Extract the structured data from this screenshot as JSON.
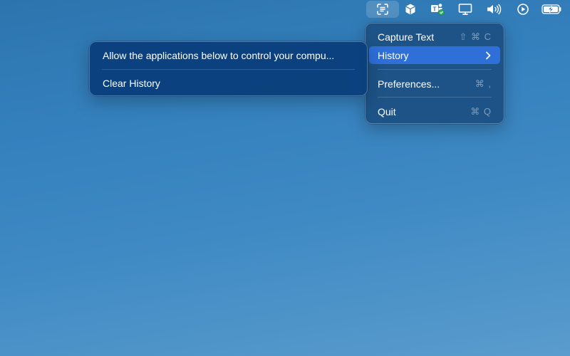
{
  "menubar": {
    "icons": [
      {
        "name": "text-capture-icon",
        "active": true
      },
      {
        "name": "cube-icon"
      },
      {
        "name": "teams-icon"
      },
      {
        "name": "display-icon"
      },
      {
        "name": "volume-icon"
      },
      {
        "name": "play-circle-icon"
      },
      {
        "name": "battery-charging-icon"
      }
    ],
    "badge_color": "#2fb84a"
  },
  "main_menu": {
    "items": [
      {
        "label": "Capture Text",
        "shortcut": "⇧ ⌘ C"
      },
      {
        "label": "History",
        "submenu": true,
        "selected": true
      },
      {
        "label": "Preferences...",
        "shortcut": "⌘ ,"
      },
      {
        "label": "Quit",
        "shortcut": "⌘ Q"
      }
    ],
    "selected_color": "#2e6fd8"
  },
  "sub_menu": {
    "items": [
      {
        "label": "Allow the applications below to control your compu..."
      },
      {
        "label": "Clear History"
      }
    ]
  }
}
